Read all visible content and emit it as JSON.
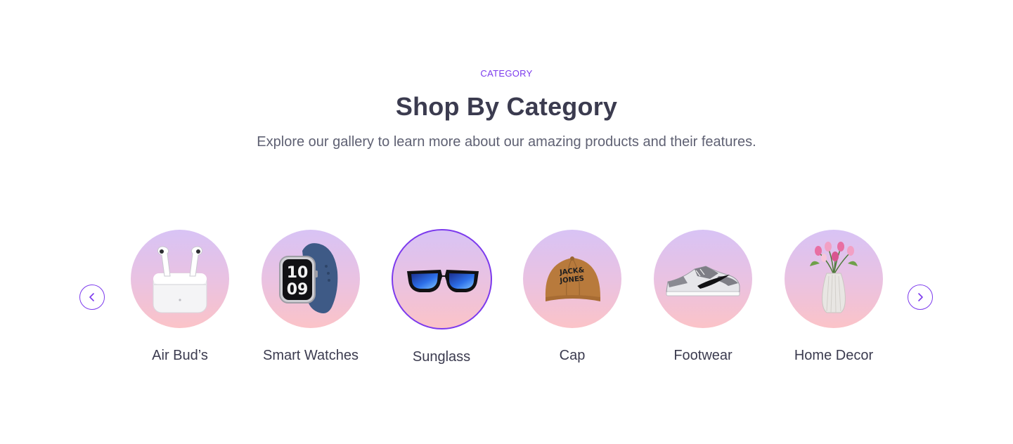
{
  "section": {
    "eyebrow": "CATEGORY",
    "title": "Shop By Category",
    "subtitle": "Explore our gallery to learn more about our amazing products and their features."
  },
  "carousel": {
    "prev_icon": "chevron-left-icon",
    "next_icon": "chevron-right-icon",
    "active_index": 2,
    "items": [
      {
        "label": "Air Bud’s",
        "icon": "earbuds-image"
      },
      {
        "label": "Smart Watches",
        "icon": "smartwatch-image"
      },
      {
        "label": "Sunglass",
        "icon": "sunglasses-image"
      },
      {
        "label": "Cap",
        "icon": "cap-image",
        "print": "JACK & JONES"
      },
      {
        "label": "Footwear",
        "icon": "sneaker-image"
      },
      {
        "label": "Home Decor",
        "icon": "vase-image"
      }
    ]
  },
  "colors": {
    "accent": "#7C3AED",
    "heading": "#3B3B4F",
    "body_text": "#5F6173",
    "circle_gradient_top": "#D8C3F5",
    "circle_gradient_bottom": "#FBC3C8"
  }
}
